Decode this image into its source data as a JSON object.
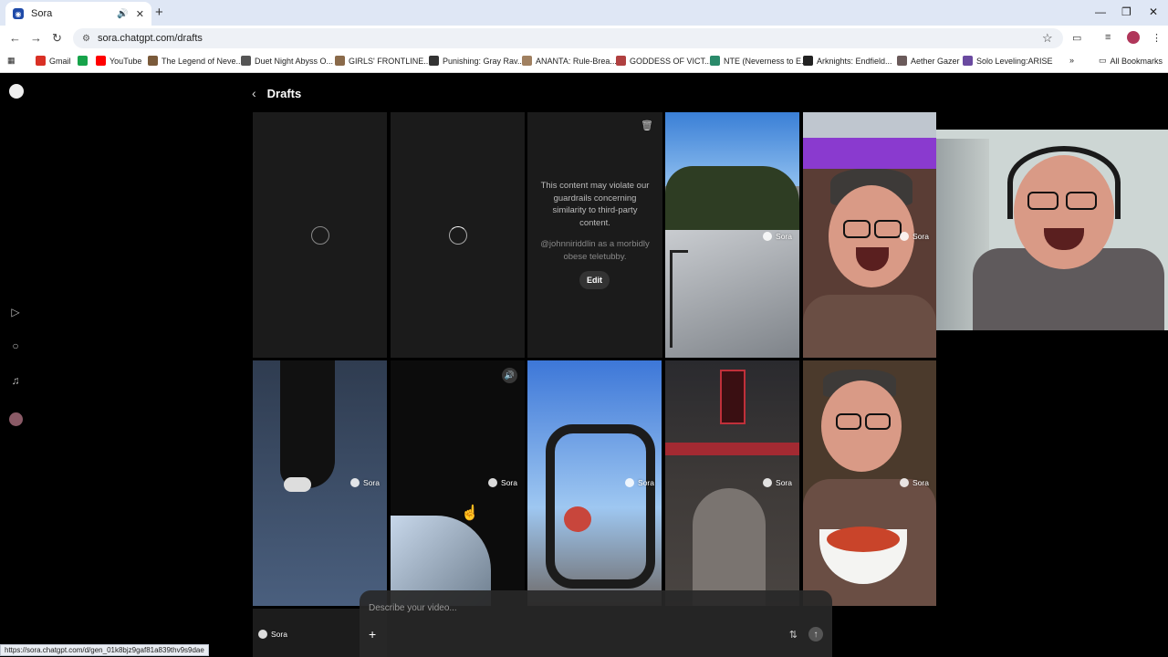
{
  "browser": {
    "tab_title": "Sora",
    "url": "sora.chatgpt.com/drafts",
    "new_tab": "+",
    "bookmarks": [
      {
        "label": "Gmail",
        "color": "#d93025"
      },
      {
        "label": "",
        "color": "#16a34a"
      },
      {
        "label": "YouTube",
        "color": "#ff0000"
      },
      {
        "label": "The Legend of Neve...",
        "color": "#7a5a3a"
      },
      {
        "label": "Duet Night Abyss O...",
        "color": "#555555"
      },
      {
        "label": "GIRLS' FRONTLINE...",
        "color": "#8a6a4a"
      },
      {
        "label": "Punishing: Gray Rav...",
        "color": "#333333"
      },
      {
        "label": "ANANTA: Rule-Brea...",
        "color": "#a08060"
      },
      {
        "label": "GODDESS OF VICT...",
        "color": "#b04040"
      },
      {
        "label": "NTE (Neverness to E...",
        "color": "#2a8a6a"
      },
      {
        "label": "Arknights: Endfield...",
        "color": "#222222"
      },
      {
        "label": "Aether Gazer",
        "color": "#6a5a5a"
      },
      {
        "label": "Solo Leveling:ARISE",
        "color": "#6a4aa0"
      }
    ],
    "all_bookmarks": "All Bookmarks",
    "status_url": "https://sora.chatgpt.com/d/gen_01k8bjz9gaf81a839thv9s9dae"
  },
  "page": {
    "title": "Drafts",
    "guardrail_text": "This content may violate our guardrails concerning similarity to third-party content.",
    "guardrail_prompt": "@johnniriddlin as a morbidly obese teletubby.",
    "edit_label": "Edit",
    "badge_label": "Sora",
    "composer_placeholder": "Describe your video..."
  },
  "colors": {
    "page_bg": "#000000",
    "tile_bg": "#1b1b1b",
    "accent": "#ffffff"
  }
}
